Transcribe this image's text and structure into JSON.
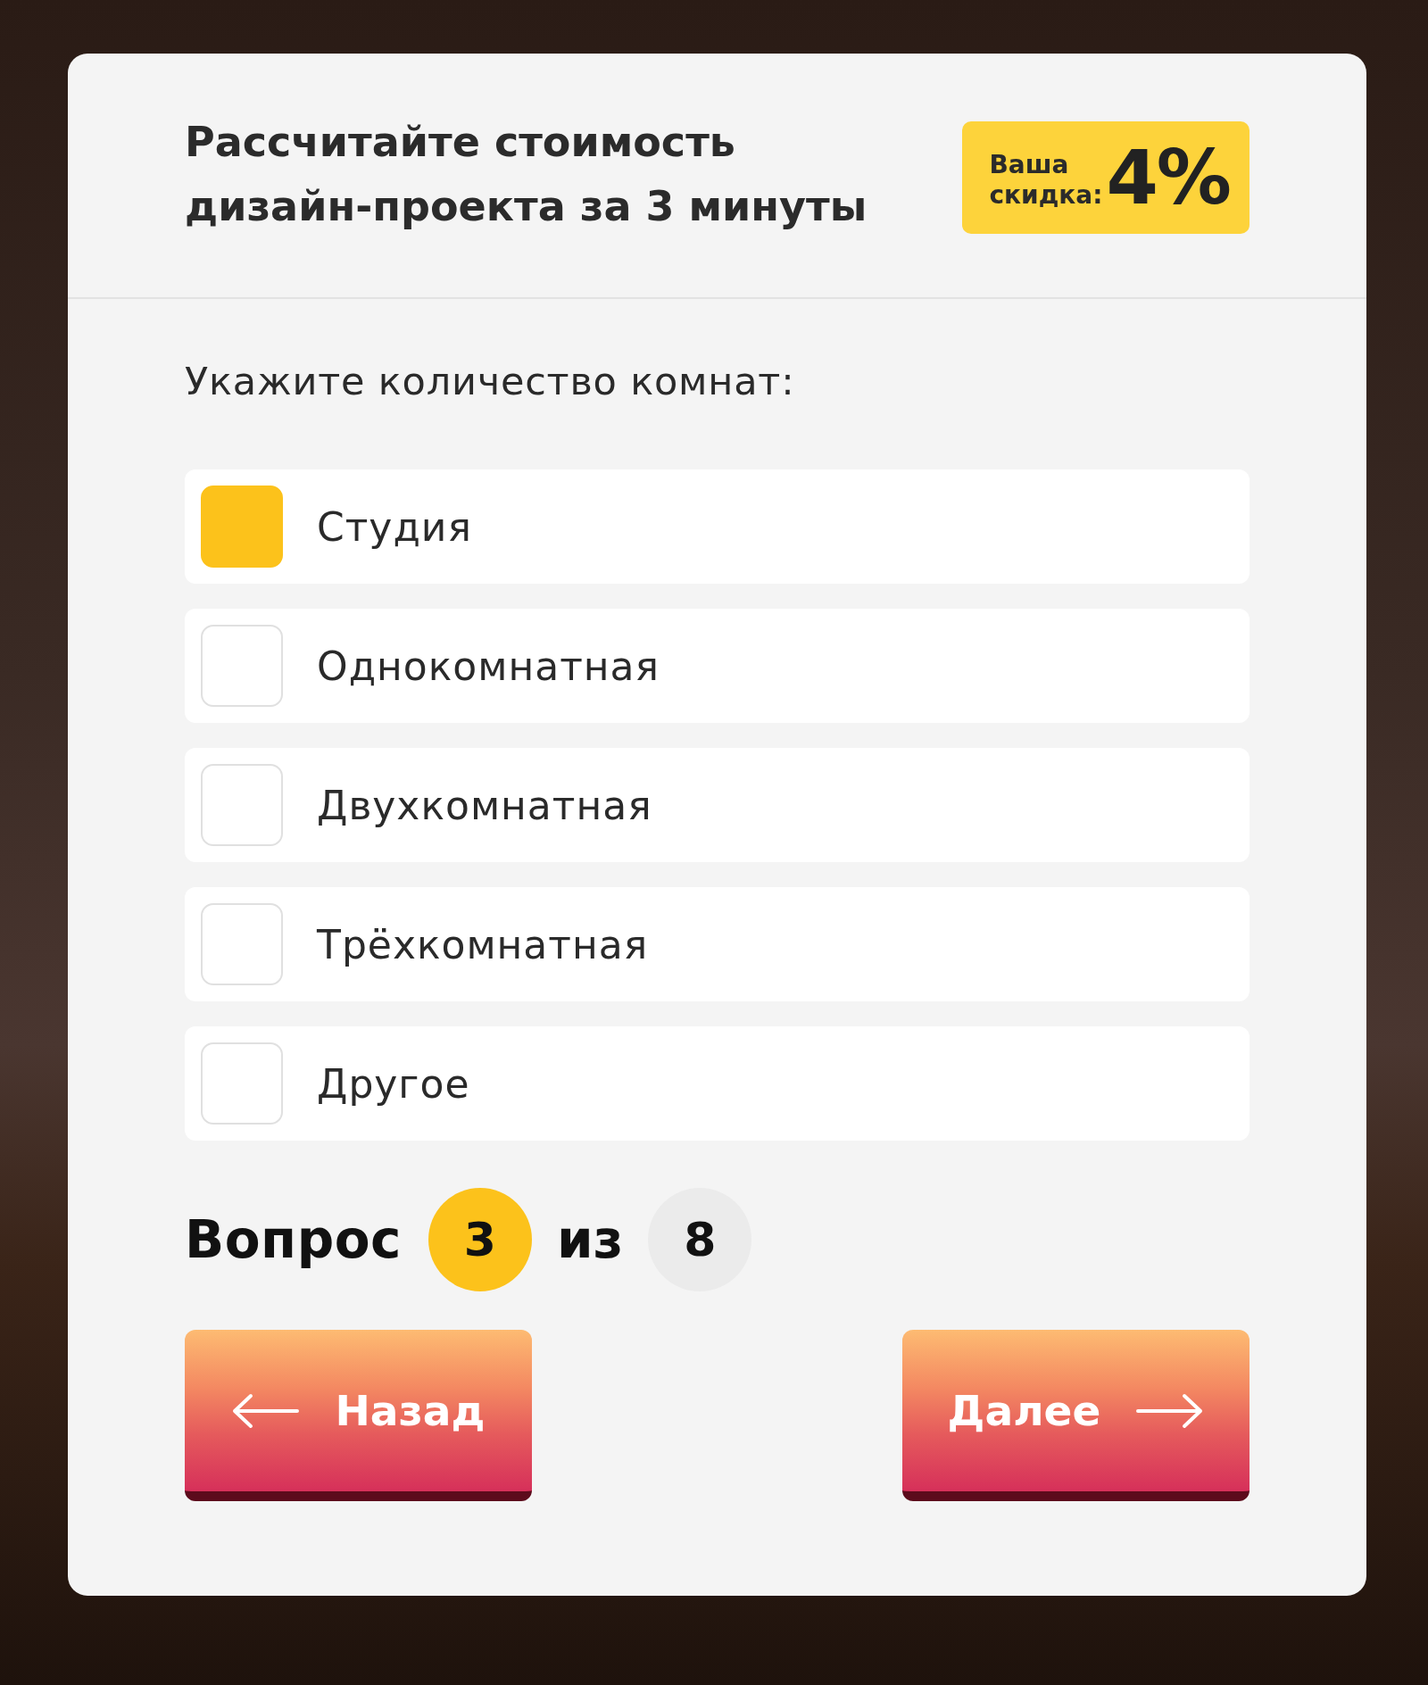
{
  "header": {
    "title": "Рассчитайте стоимость дизайн-проекта за 3 минуты",
    "discount": {
      "label": "Ваша скидка:",
      "value": "4%"
    }
  },
  "question": "Укажите количество комнат:",
  "options": [
    {
      "label": "Студия",
      "selected": true
    },
    {
      "label": "Однокомнатная",
      "selected": false
    },
    {
      "label": "Двухкомнатная",
      "selected": false
    },
    {
      "label": "Трёхкомнатная",
      "selected": false
    },
    {
      "label": "Другое",
      "selected": false
    }
  ],
  "progress": {
    "label": "Вопрос",
    "current": "3",
    "separator": "из",
    "total": "8"
  },
  "buttons": [
    {
      "kind": "back",
      "label": "Назад"
    },
    {
      "kind": "next",
      "label": "Далее"
    }
  ]
}
